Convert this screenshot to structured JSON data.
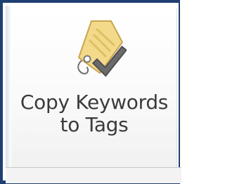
{
  "button": {
    "label_line1": "Copy Keywords",
    "label_line2": "to Tags",
    "icon": "tag-checkmark-icon"
  },
  "colors": {
    "frame_border": "#1f3f73",
    "tag_fill": "#f3d98a",
    "checkmark": "#555555"
  }
}
